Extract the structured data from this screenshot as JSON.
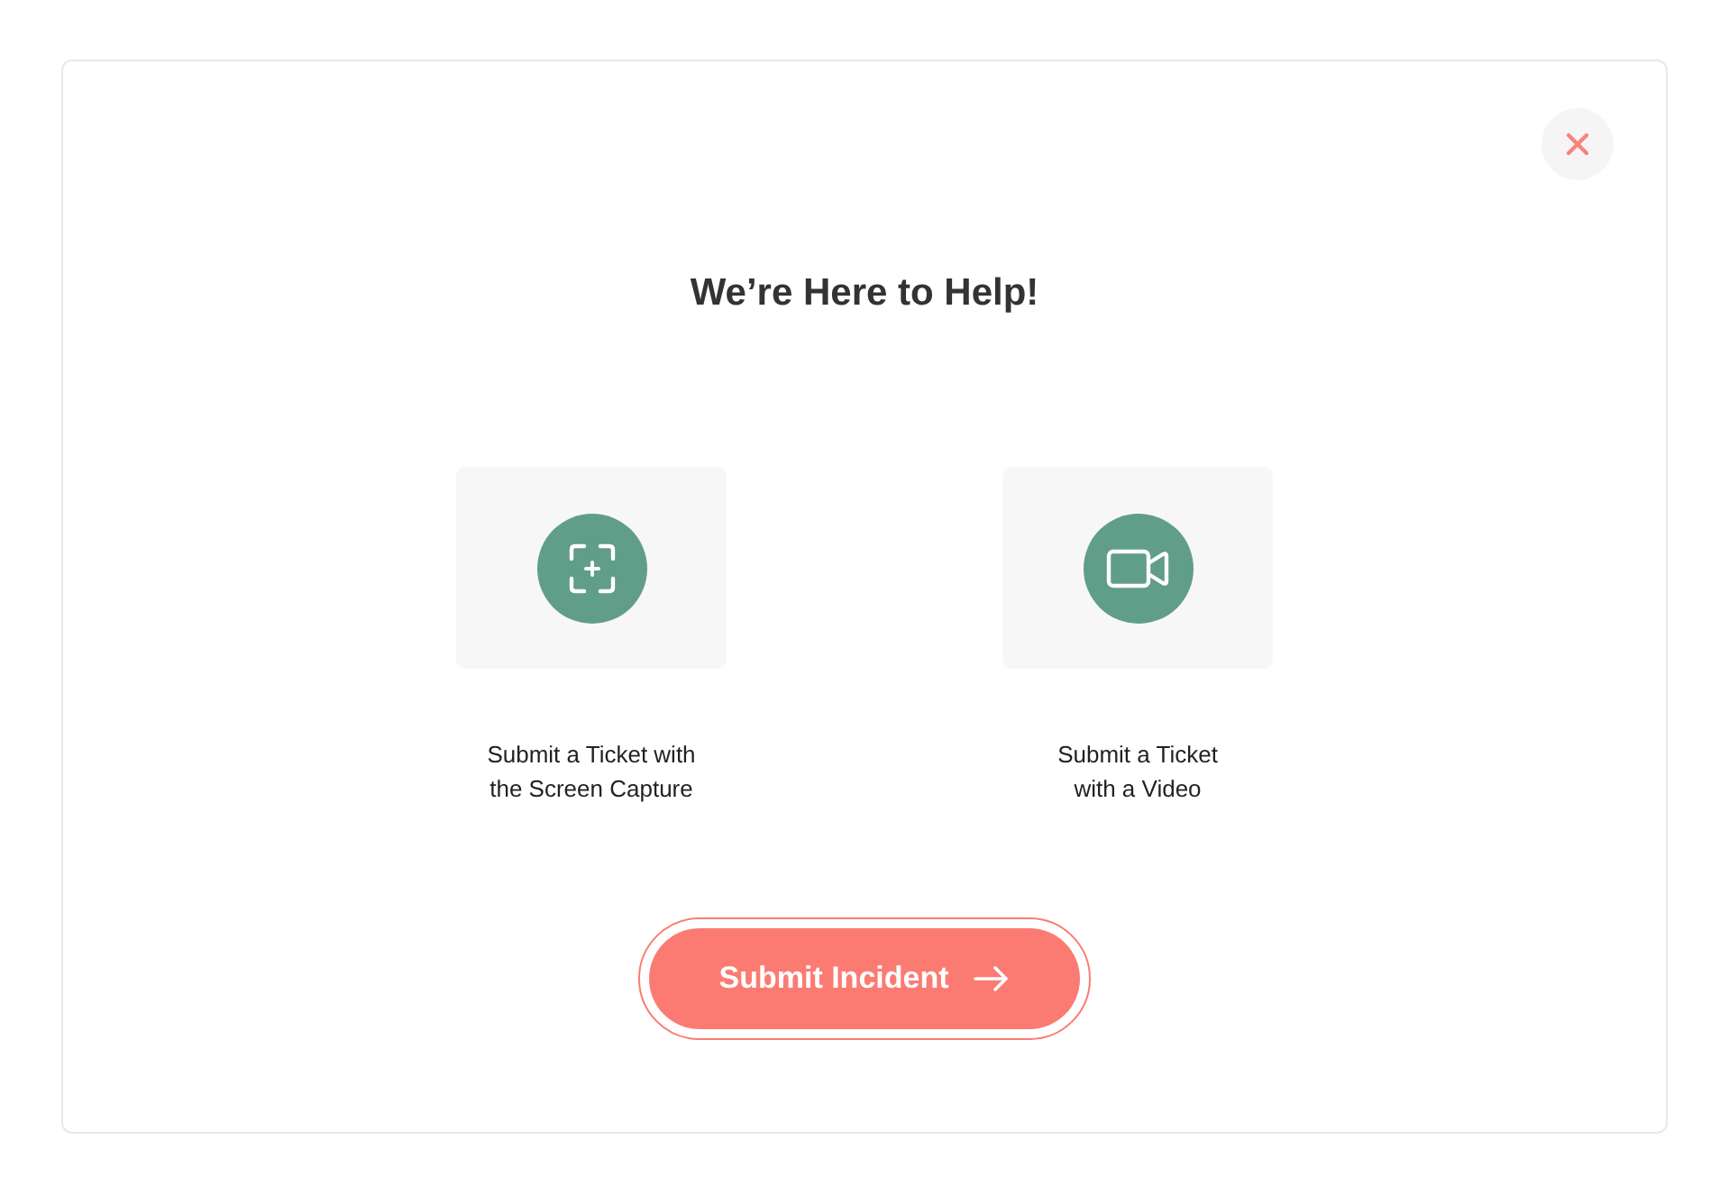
{
  "title": "We’re Here to Help!",
  "options": [
    {
      "kind": "screen_capture",
      "label": "Submit a Ticket with\nthe Screen Capture"
    },
    {
      "kind": "video",
      "label": "Submit a Ticket\nwith a Video"
    }
  ],
  "submit": {
    "label": "Submit Incident"
  }
}
